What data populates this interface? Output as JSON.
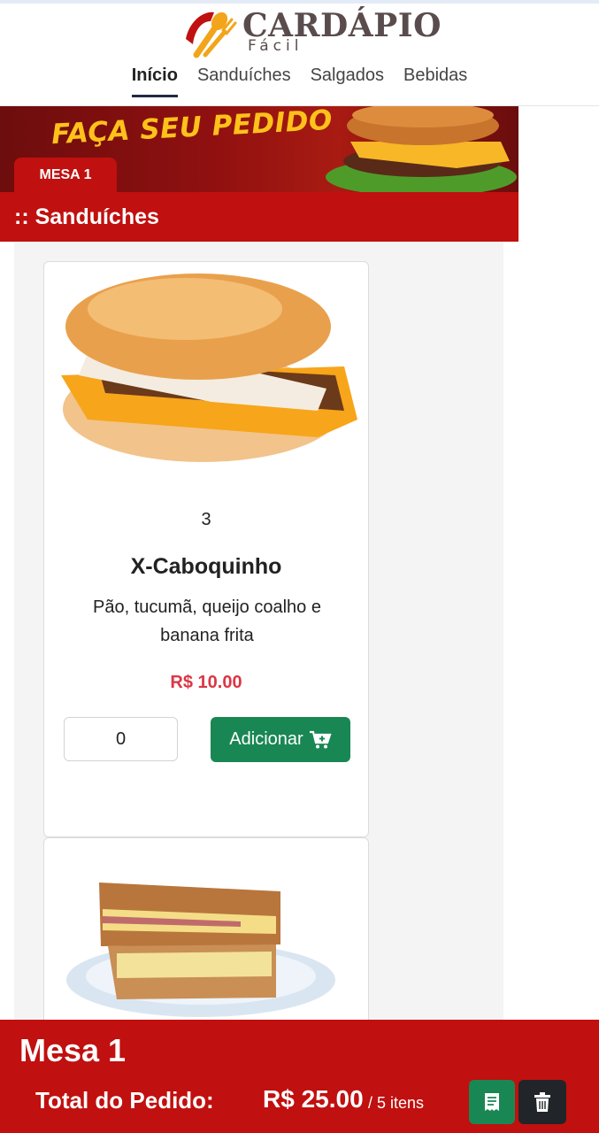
{
  "brand": {
    "title": "CARDÁPIO",
    "subtitle": "Fácil"
  },
  "nav": {
    "items": [
      {
        "label": "Início",
        "active": true
      },
      {
        "label": "Sanduíches",
        "active": false
      },
      {
        "label": "Salgados",
        "active": false
      },
      {
        "label": "Bebidas",
        "active": false
      }
    ]
  },
  "banner": {
    "title": "FAÇA SEU PEDIDO",
    "table_tab": "MESA 1"
  },
  "section": {
    "title": ":: Sanduíches"
  },
  "products": [
    {
      "qty_label": "3",
      "name": "X-Caboquinho",
      "description": "Pão, tucumã, queijo coalho e banana frita",
      "price": "R$ 10.00",
      "quantity_value": "0",
      "add_label": "Adicionar"
    }
  ],
  "footer": {
    "table": "Mesa 1",
    "total_label": "Total do Pedido:",
    "total_value": "R$ 25.00",
    "items": "/ 5 itens"
  },
  "colors": {
    "brand_red": "#c0100f",
    "success": "#198754",
    "price": "#dc3545",
    "dark": "#212529"
  },
  "icons": [
    "logo-fork-spoon-icon",
    "cart-plus-icon",
    "receipt-icon",
    "trash-icon"
  ]
}
